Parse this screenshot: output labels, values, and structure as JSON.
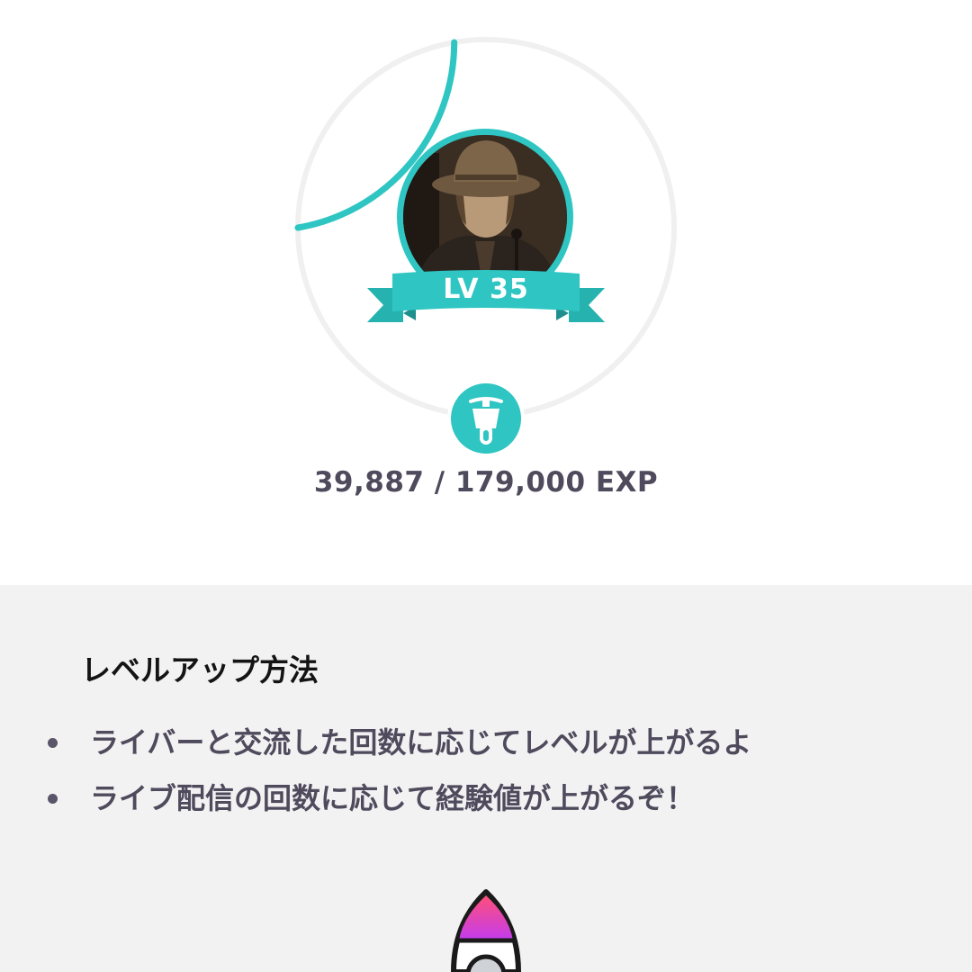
{
  "profile": {
    "level_label": "LV 35",
    "exp_text": "39,887 / 179,000 EXP",
    "progress_fraction": 0.223,
    "avatar": "profile-photo-man-in-hat",
    "badge_icon": "scooter-icon"
  },
  "colors": {
    "accent": "#2ec5c2",
    "ring_track": "#f0f0f0",
    "text_muted": "#4f4a5c",
    "panel_bg": "#f2f2f3"
  },
  "level_up": {
    "title": "レベルアップ方法",
    "items": [
      "ライバーと交流した回数に応じてレベルが上がるよ",
      "ライブ配信の回数に応じて経験値が上がるぞ！"
    ]
  },
  "decoration": {
    "icon": "rocket-icon"
  }
}
